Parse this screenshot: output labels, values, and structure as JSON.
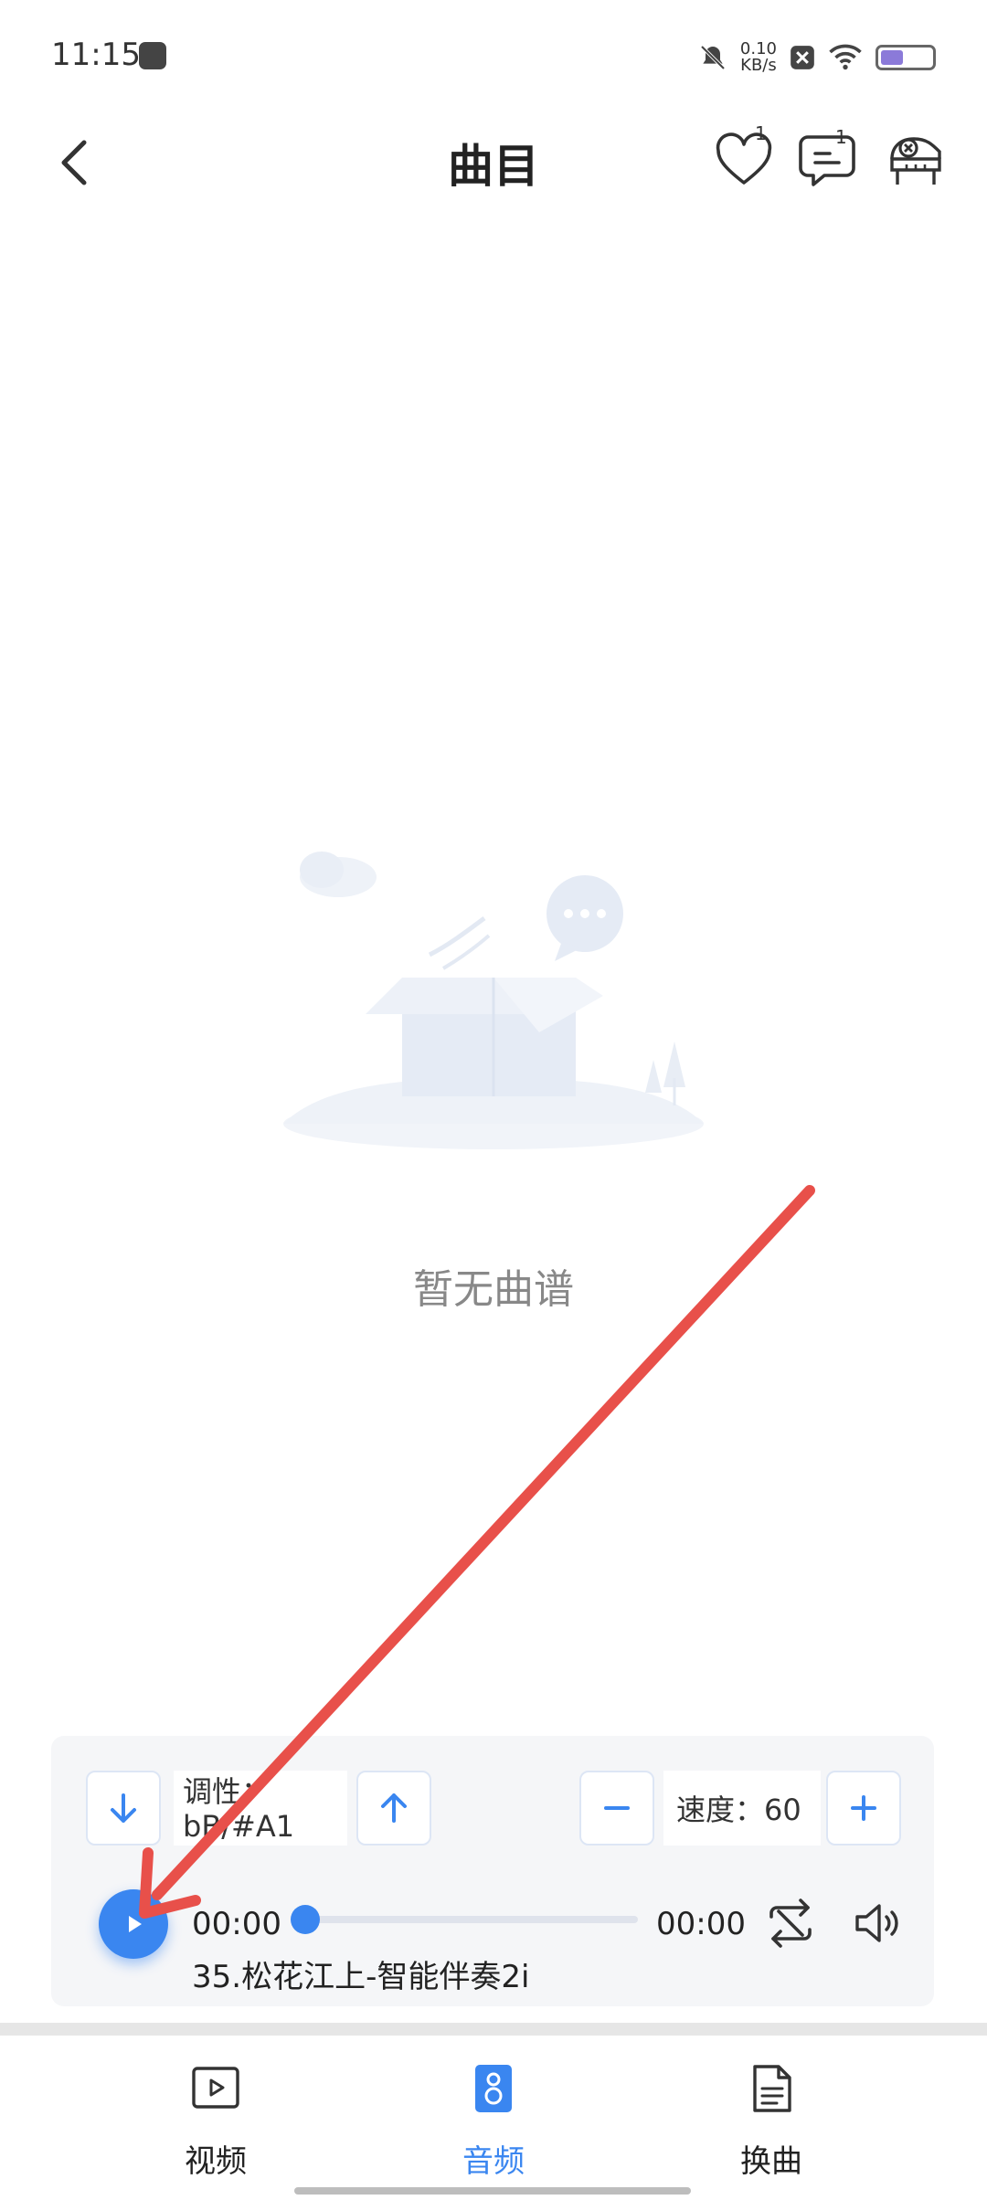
{
  "status_bar": {
    "time": "11:15",
    "net_speed_value": "0.10",
    "net_speed_unit": "KB/s"
  },
  "header": {
    "title": "曲目",
    "favorite_badge": "1",
    "comment_badge": "1"
  },
  "empty_state": {
    "message": "暂无曲谱"
  },
  "player": {
    "key_label": "调性：bB/#A1",
    "speed_label": "速度：60",
    "current_time": "00:00",
    "total_time": "00:00",
    "progress": 0.0,
    "track_title": "35.松花江上-智能伴奏2i"
  },
  "bottom_nav": {
    "items": [
      {
        "label": "视频",
        "active": false
      },
      {
        "label": "音频",
        "active": true
      },
      {
        "label": "换曲",
        "active": false
      }
    ]
  },
  "colors": {
    "accent": "#3a86f0",
    "annotation_arrow": "#e8504a"
  }
}
